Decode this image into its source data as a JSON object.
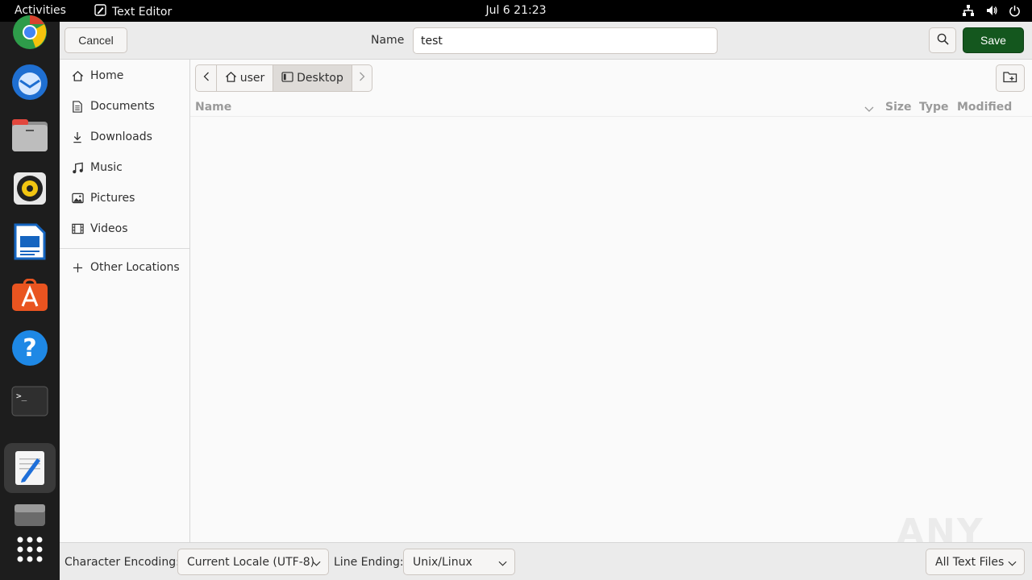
{
  "topbar": {
    "activities": "Activities",
    "app_name": "Text Editor",
    "clock": "Jul 6  21:23"
  },
  "dock": {
    "apps": [
      "chrome-icon",
      "thunderbird-icon",
      "files-icon",
      "rhythmbox-icon",
      "writer-icon",
      "app-center-icon",
      "help-icon",
      "terminal-icon",
      "text-editor-icon",
      "disk-icon",
      "show-apps-icon"
    ]
  },
  "header": {
    "cancel_label": "Cancel",
    "name_label": "Name",
    "filename_value": "test",
    "save_label": "Save"
  },
  "sidebar": {
    "places": [
      {
        "label": "Home",
        "icon": "home-icon"
      },
      {
        "label": "Documents",
        "icon": "documents-icon"
      },
      {
        "label": "Downloads",
        "icon": "downloads-icon"
      },
      {
        "label": "Music",
        "icon": "music-icon"
      },
      {
        "label": "Pictures",
        "icon": "pictures-icon"
      },
      {
        "label": "Videos",
        "icon": "videos-icon"
      }
    ],
    "other_locations": "Other Locations"
  },
  "pathbar": {
    "segments": [
      "user",
      "Desktop"
    ]
  },
  "columns": {
    "name": "Name",
    "size": "Size",
    "type": "Type",
    "modified": "Modified"
  },
  "footer": {
    "encoding_label": "Character Encoding:",
    "encoding_value": "Current Locale (UTF-8)",
    "line_ending_label": "Line Ending:",
    "line_ending_value": "Unix/Linux",
    "filter_value": "All Text Files"
  },
  "watermark": "ANY RUN",
  "colors": {
    "save_green": "#14571e",
    "dock_bg": "#1d1d1d",
    "accent": "#e95420"
  }
}
